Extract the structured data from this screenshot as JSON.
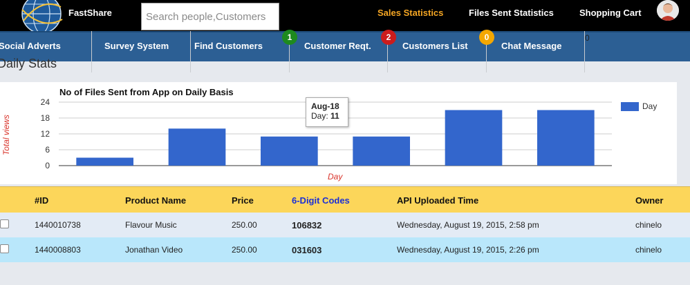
{
  "topbar": {
    "brand": "FastShare",
    "search_placeholder": "Search people,Customers",
    "links": [
      "Sales Statistics",
      "Files Sent Statistics",
      "Shopping Cart"
    ]
  },
  "nav": {
    "items": [
      "Social Adverts",
      "Survey System",
      "Find Customers",
      "Customer Reqt.",
      "Customers List",
      "Chat Message"
    ],
    "badges": [
      "1",
      "2",
      "0"
    ],
    "stray": "0"
  },
  "section_title": "Daily Stats",
  "chart_data": {
    "type": "bar",
    "title": "No of Files Sent from App on Daily Basis",
    "xlabel": "Day",
    "ylabel": "Total views",
    "ylim": [
      0,
      24
    ],
    "yticks": [
      "24",
      "18",
      "12",
      "6",
      "0"
    ],
    "series": [
      {
        "name": "Day",
        "values": [
          3,
          14,
          11,
          11,
          21,
          21
        ]
      }
    ],
    "legend": "right",
    "tooltip": {
      "category": "Aug-18",
      "label": "Day:",
      "value": "11"
    }
  },
  "table": {
    "headers": [
      "#ID",
      "Product Name",
      "Price",
      "6-Digit Codes",
      "API Uploaded Time",
      "Owner"
    ],
    "rows": [
      {
        "id": "1440010738",
        "name": "Flavour Music",
        "price": "250.00",
        "code": "106832",
        "time": "Wednesday, August 19, 2015, 2:58 pm",
        "owner": "chinelo"
      },
      {
        "id": "1440008803",
        "name": "Jonathan Video",
        "price": "250.00",
        "code": "031603",
        "time": "Wednesday, August 19, 2015, 2:26 pm",
        "owner": "chinelo"
      }
    ]
  },
  "colors": {
    "bar": "#3366cc",
    "accent": "#f5a623",
    "nav": "#2c5f94",
    "table_head": "#fcd65a"
  }
}
